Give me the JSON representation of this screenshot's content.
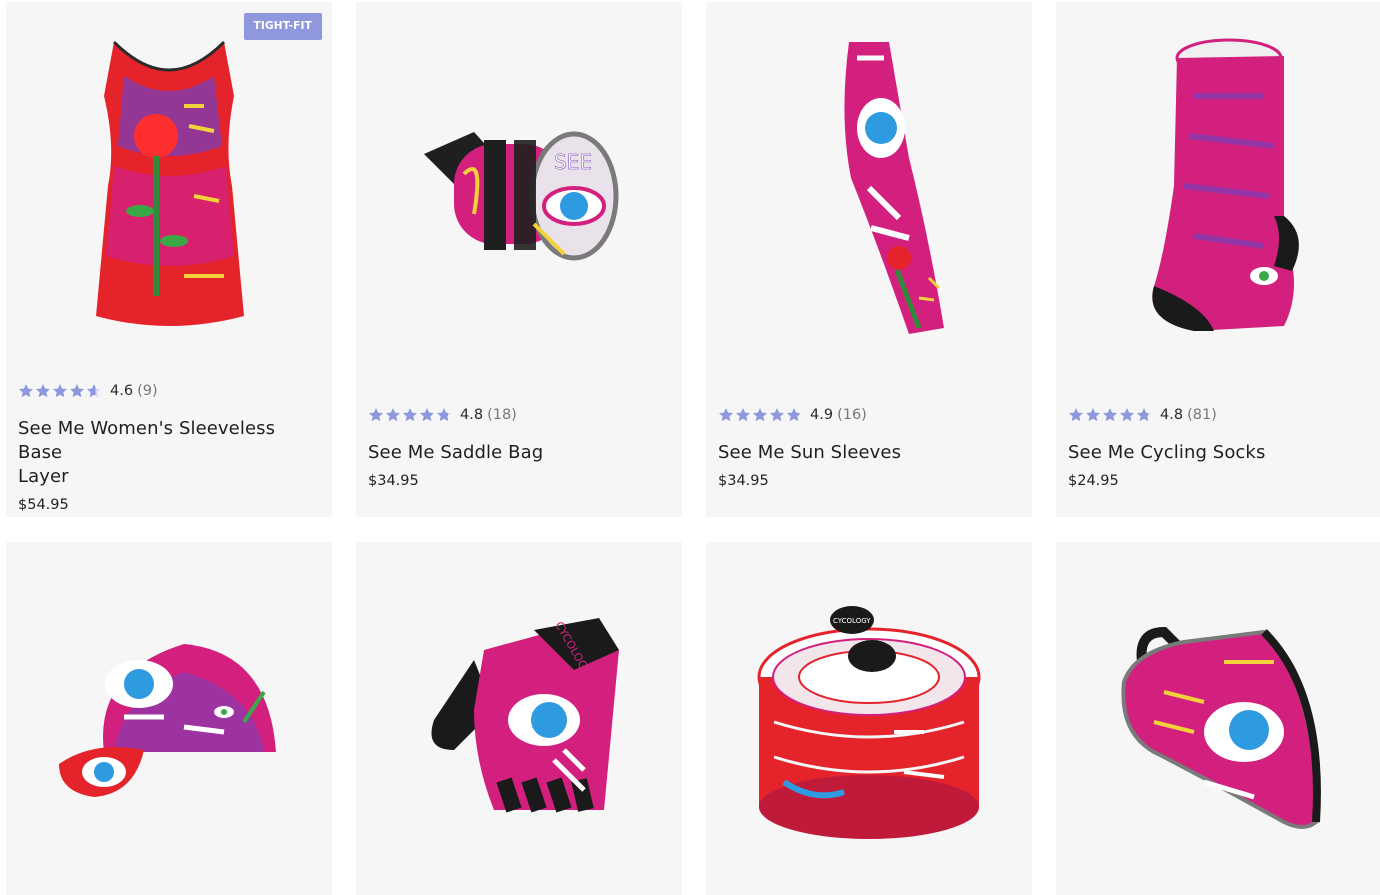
{
  "colors": {
    "card_bg": "#f6f6f6",
    "badge_bg": "#8f98dc",
    "star": "#8f98dc",
    "fabric_magenta": "#d3207f",
    "fabric_red": "#e4232a",
    "fabric_purple": "#7a3fb8",
    "eye_blue": "#2e9be0"
  },
  "products": [
    {
      "badge": "TIGHT-FIT",
      "rating": "4.6",
      "count": "(9)",
      "title_line1": "See Me Women's Sleeveless Base",
      "title_line2": "Layer",
      "price": "$54.95",
      "stars_filled": 4.6,
      "icon": "sleeveless-jersey-icon"
    },
    {
      "badge": "",
      "rating": "4.8",
      "count": "(18)",
      "title_line1": "See Me Saddle Bag",
      "title_line2": "",
      "price": "$34.95",
      "stars_filled": 4.8,
      "icon": "saddle-bag-icon"
    },
    {
      "badge": "",
      "rating": "4.9",
      "count": "(16)",
      "title_line1": "See Me Sun Sleeves",
      "title_line2": "",
      "price": "$34.95",
      "stars_filled": 4.9,
      "icon": "arm-sleeve-icon"
    },
    {
      "badge": "",
      "rating": "4.8",
      "count": "(81)",
      "title_line1": "See Me Cycling Socks",
      "title_line2": "",
      "price": "$24.95",
      "stars_filled": 4.8,
      "icon": "sock-icon"
    },
    {
      "icon": "cycling-cap-icon"
    },
    {
      "icon": "glove-icon",
      "brand_text": "CYCOLOGY"
    },
    {
      "icon": "bar-tape-icon",
      "brand_text": "CYCOLOGY"
    },
    {
      "icon": "frame-bag-icon"
    }
  ]
}
